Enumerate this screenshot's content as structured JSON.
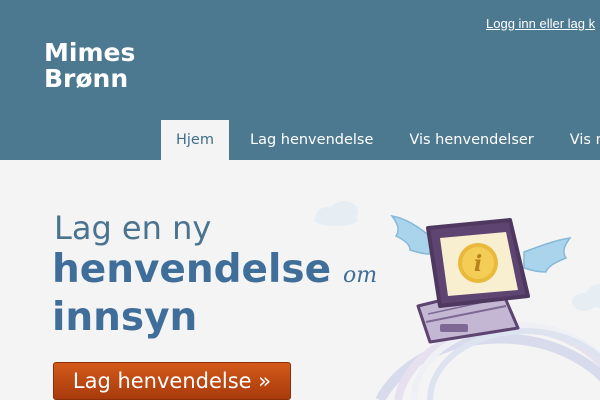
{
  "header": {
    "logo_line1": "Mimes",
    "logo_line2": "Brønn",
    "login_link": "Logg inn eller lag k"
  },
  "nav": {
    "items": [
      {
        "label": "Hjem",
        "active": true
      },
      {
        "label": "Lag henvendelse",
        "active": false
      },
      {
        "label": "Vis henvendelser",
        "active": false
      },
      {
        "label": "Vis m",
        "active": false
      }
    ]
  },
  "hero": {
    "line1": "Lag en ny",
    "line2": "henvendelse",
    "line2_suffix": "om",
    "line3": "innsyn",
    "cta_label": "Lag henvendelse »"
  },
  "illustration": {
    "icon": "info-icon",
    "info_glyph": "i"
  },
  "colors": {
    "header_bg": "#4c7890",
    "page_bg": "#f4f4f4",
    "heading": "#3f6e9a",
    "cta": "#c04a14"
  }
}
